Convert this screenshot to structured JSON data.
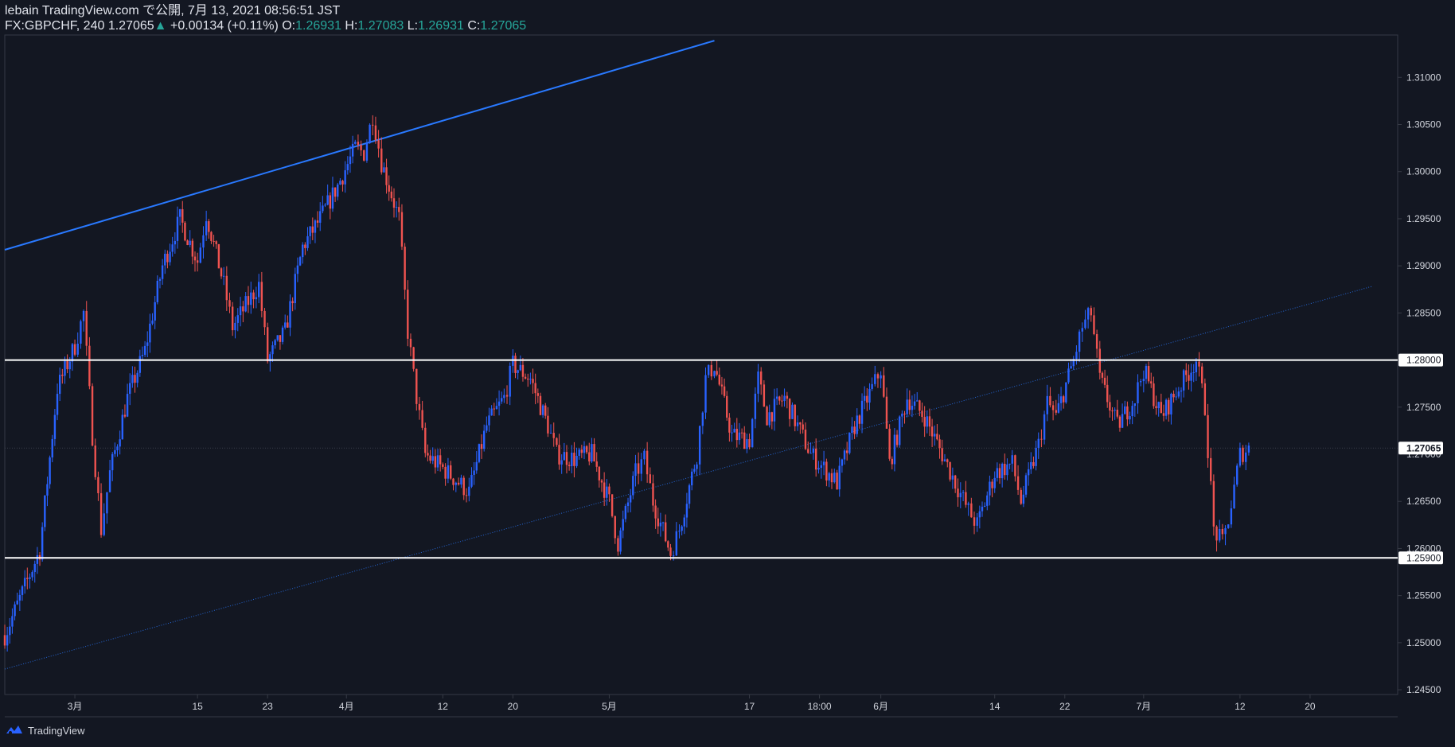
{
  "header": {
    "line1": "lebain TradingView.com で公開, 7月 13, 2021 08:56:51 JST",
    "symbol": "FX:GBPCHF, 240",
    "last": "1.27065",
    "change_arrow": "▲",
    "change": "+0.00134 (+0.11%)",
    "o_label": "O:",
    "o": "1.26931",
    "h_label": "H:",
    "h": "1.27083",
    "l_label": "L:",
    "l": "1.26931",
    "c_label": "C:",
    "c": "1.27065"
  },
  "footer": {
    "brand": "TradingView",
    "icon": "tradingview-logo-icon"
  },
  "colors": {
    "background": "#131722",
    "up": "#2962ff",
    "down": "#ef5350",
    "trendline": "#2979ff",
    "level": "#ffffff",
    "axis": "#363a45",
    "text": "#d1d4dc"
  },
  "chart_data": {
    "type": "candlestick",
    "symbol": "FX:GBPCHF",
    "interval": "240",
    "ylim": [
      1.2445,
      1.3145
    ],
    "y_ticks": [
      "1.31000",
      "1.30500",
      "1.30000",
      "1.29500",
      "1.29000",
      "1.28500",
      "1.28000",
      "1.27500",
      "1.27000",
      "1.26500",
      "1.26000",
      "1.25500",
      "1.25000",
      "1.24500"
    ],
    "x_ticks": [
      "3月",
      "15",
      "23",
      "4月",
      "12",
      "20",
      "5月",
      "17",
      "18:00",
      "6月",
      "14",
      "22",
      "7月",
      "12",
      "20"
    ],
    "horizontal_levels": [
      {
        "value": 1.28,
        "label": "1.28000"
      },
      {
        "value": 1.259,
        "label": "1.25900"
      }
    ],
    "last_price_label": "1.27065",
    "trendlines": [
      {
        "style": "solid",
        "points": [
          {
            "date": "2021-02-21",
            "price": 1.2917
          },
          {
            "date": "2021-05-13",
            "price": 1.3139
          }
        ]
      },
      {
        "style": "dotted",
        "points": [
          {
            "date": "2021-02-21",
            "price": 1.2472
          },
          {
            "date": "2021-07-27",
            "price": 1.2878
          }
        ]
      }
    ],
    "keypoints": [
      {
        "date": "2021-02-21",
        "price": 1.2508
      },
      {
        "date": "2021-02-25",
        "price": 1.2598
      },
      {
        "date": "2021-02-27",
        "price": 1.277
      },
      {
        "date": "2021-03-01",
        "price": 1.2815
      },
      {
        "date": "2021-03-02",
        "price": 1.285
      },
      {
        "date": "2021-03-03",
        "price": 1.272
      },
      {
        "date": "2021-03-04",
        "price": 1.262
      },
      {
        "date": "2021-03-05",
        "price": 1.268
      },
      {
        "date": "2021-03-07",
        "price": 1.276
      },
      {
        "date": "2021-03-09",
        "price": 1.281
      },
      {
        "date": "2021-03-11",
        "price": 1.29
      },
      {
        "date": "2021-03-13",
        "price": 1.295
      },
      {
        "date": "2021-03-15",
        "price": 1.2905
      },
      {
        "date": "2021-03-16",
        "price": 1.2955
      },
      {
        "date": "2021-03-18",
        "price": 1.288
      },
      {
        "date": "2021-03-19",
        "price": 1.2835
      },
      {
        "date": "2021-03-22",
        "price": 1.288
      },
      {
        "date": "2021-03-23",
        "price": 1.28
      },
      {
        "date": "2021-03-25",
        "price": 1.283
      },
      {
        "date": "2021-03-27",
        "price": 1.292
      },
      {
        "date": "2021-03-29",
        "price": 1.295
      },
      {
        "date": "2021-03-31",
        "price": 1.2985
      },
      {
        "date": "2021-04-02",
        "price": 1.3025
      },
      {
        "date": "2021-04-03",
        "price": 1.302
      },
      {
        "date": "2021-04-04",
        "price": 1.306
      },
      {
        "date": "2021-04-05",
        "price": 1.301
      },
      {
        "date": "2021-04-07",
        "price": 1.295
      },
      {
        "date": "2021-04-08",
        "price": 1.283
      },
      {
        "date": "2021-04-09",
        "price": 1.276
      },
      {
        "date": "2021-04-10",
        "price": 1.27
      },
      {
        "date": "2021-04-12",
        "price": 1.2685
      },
      {
        "date": "2021-04-15",
        "price": 1.266
      },
      {
        "date": "2021-04-17",
        "price": 1.273
      },
      {
        "date": "2021-04-19",
        "price": 1.276
      },
      {
        "date": "2021-04-20",
        "price": 1.2795
      },
      {
        "date": "2021-04-22",
        "price": 1.278
      },
      {
        "date": "2021-04-24",
        "price": 1.273
      },
      {
        "date": "2021-04-25",
        "price": 1.27
      },
      {
        "date": "2021-04-27",
        "price": 1.2695
      },
      {
        "date": "2021-04-29",
        "price": 1.27
      },
      {
        "date": "2021-05-01",
        "price": 1.265
      },
      {
        "date": "2021-05-02",
        "price": 1.2605
      },
      {
        "date": "2021-05-04",
        "price": 1.268
      },
      {
        "date": "2021-05-05",
        "price": 1.2695
      },
      {
        "date": "2021-05-06",
        "price": 1.265
      },
      {
        "date": "2021-05-08",
        "price": 1.2595
      },
      {
        "date": "2021-05-09",
        "price": 1.262
      },
      {
        "date": "2021-05-11",
        "price": 1.27
      },
      {
        "date": "2021-05-12",
        "price": 1.278
      },
      {
        "date": "2021-05-13",
        "price": 1.2795
      },
      {
        "date": "2021-05-15",
        "price": 1.272
      },
      {
        "date": "2021-05-17",
        "price": 1.2715
      },
      {
        "date": "2021-05-18",
        "price": 1.278
      },
      {
        "date": "2021-05-19",
        "price": 1.274
      },
      {
        "date": "2021-05-21",
        "price": 1.276
      },
      {
        "date": "2021-05-24",
        "price": 1.27
      },
      {
        "date": "2021-05-27",
        "price": 1.267
      },
      {
        "date": "2021-05-29",
        "price": 1.273
      },
      {
        "date": "2021-05-31",
        "price": 1.277
      },
      {
        "date": "2021-06-01",
        "price": 1.279
      },
      {
        "date": "2021-06-02",
        "price": 1.269
      },
      {
        "date": "2021-06-04",
        "price": 1.276
      },
      {
        "date": "2021-06-06",
        "price": 1.274
      },
      {
        "date": "2021-06-08",
        "price": 1.27
      },
      {
        "date": "2021-06-11",
        "price": 1.264
      },
      {
        "date": "2021-06-12",
        "price": 1.2625
      },
      {
        "date": "2021-06-14",
        "price": 1.268
      },
      {
        "date": "2021-06-16",
        "price": 1.269
      },
      {
        "date": "2021-06-17",
        "price": 1.265
      },
      {
        "date": "2021-06-19",
        "price": 1.271
      },
      {
        "date": "2021-06-20",
        "price": 1.2755
      },
      {
        "date": "2021-06-21",
        "price": 1.274
      },
      {
        "date": "2021-06-23",
        "price": 1.28
      },
      {
        "date": "2021-06-24",
        "price": 1.2835
      },
      {
        "date": "2021-06-25",
        "price": 1.285
      },
      {
        "date": "2021-06-26",
        "price": 1.278
      },
      {
        "date": "2021-06-28",
        "price": 1.273
      },
      {
        "date": "2021-06-30",
        "price": 1.276
      },
      {
        "date": "2021-07-01",
        "price": 1.279
      },
      {
        "date": "2021-07-03",
        "price": 1.274
      },
      {
        "date": "2021-07-05",
        "price": 1.277
      },
      {
        "date": "2021-07-07",
        "price": 1.28
      },
      {
        "date": "2021-07-08",
        "price": 1.275
      },
      {
        "date": "2021-07-09",
        "price": 1.262
      },
      {
        "date": "2021-07-10",
        "price": 1.2605
      },
      {
        "date": "2021-07-11",
        "price": 1.2645
      },
      {
        "date": "2021-07-12",
        "price": 1.27
      },
      {
        "date": "2021-07-13",
        "price": 1.27065
      }
    ]
  }
}
